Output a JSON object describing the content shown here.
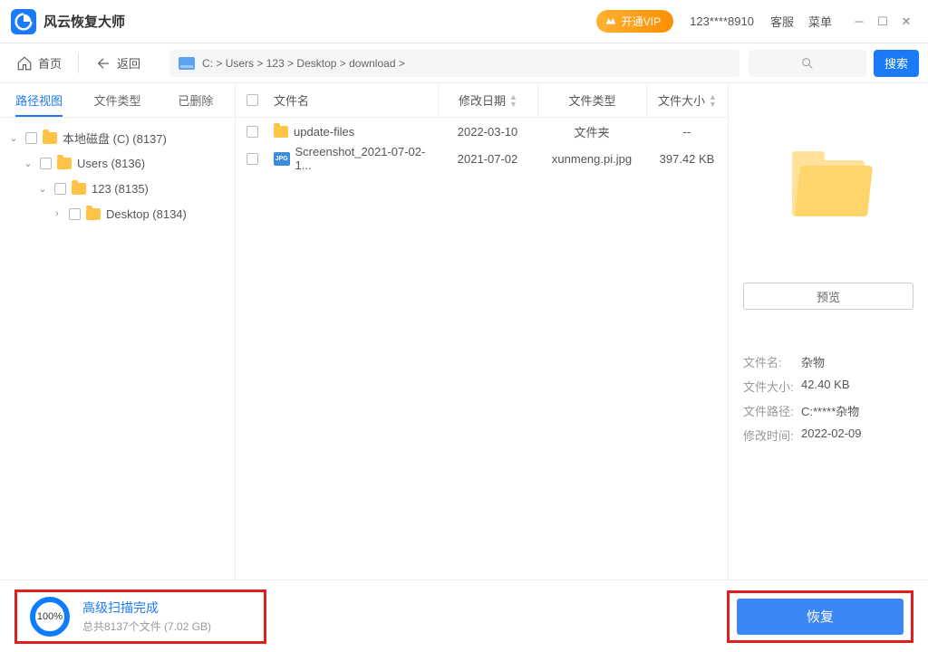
{
  "app": {
    "title": "风云恢复大师"
  },
  "titlebar": {
    "vip_label": "开通VIP",
    "user_id": "123****8910",
    "support": "客服",
    "menu": "菜单"
  },
  "toolbar": {
    "home": "首页",
    "back": "返回",
    "breadcrumb": "C:  >  Users  >  123  >  Desktop  >  download  >",
    "search": "搜索"
  },
  "tabs": {
    "path": "路径视图",
    "type": "文件类型",
    "deleted": "已删除"
  },
  "tree": [
    {
      "indent": 0,
      "label": "本地磁盘 (C) (8137)"
    },
    {
      "indent": 1,
      "label": "Users (8136)"
    },
    {
      "indent": 2,
      "label": "123 (8135)"
    },
    {
      "indent": 3,
      "label": "Desktop (8134)",
      "collapsed": true
    }
  ],
  "columns": {
    "name": "文件名",
    "date": "修改日期",
    "type": "文件类型",
    "size": "文件大小"
  },
  "files": [
    {
      "icon": "folder",
      "name": "update-files",
      "date": "2022-03-10",
      "type": "文件夹",
      "size": "--"
    },
    {
      "icon": "jpg",
      "name": "Screenshot_2021-07-02-1...",
      "date": "2021-07-02",
      "type": "xunmeng.pi.jpg",
      "size": "397.42  KB"
    }
  ],
  "preview": {
    "button": "预览",
    "meta": {
      "name_k": "文件名:",
      "name_v": "杂物",
      "size_k": "文件大小:",
      "size_v": "42.40 KB",
      "path_k": "文件路径:",
      "path_v": "C:*****杂物",
      "date_k": "修改时间:",
      "date_v": "2022-02-09"
    }
  },
  "status": {
    "percent": "100%",
    "title": "高级扫描完成",
    "subtitle": "总共8137个文件 (7.02 GB)"
  },
  "recover": "恢复"
}
